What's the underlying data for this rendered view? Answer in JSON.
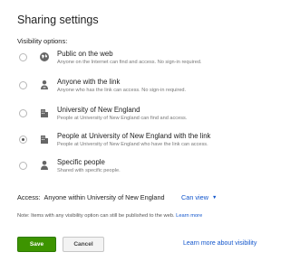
{
  "dialog": {
    "title": "Sharing settings",
    "section_label": "Visibility options:"
  },
  "options": [
    {
      "icon": "globe-icon",
      "title": "Public on the web",
      "description": "Anyone on the Internet can find and access. No sign-in required.",
      "selected": false
    },
    {
      "icon": "link-person-icon",
      "title": "Anyone with the link",
      "description": "Anyone who has the link can access. No sign-in required.",
      "selected": false
    },
    {
      "icon": "building-icon",
      "title": "University of New England",
      "description": "People at University of New England can find and access.",
      "selected": false
    },
    {
      "icon": "building-icon",
      "title": "People at University of New England with the link",
      "description": "People at University of New England who have the link can access.",
      "selected": true
    },
    {
      "icon": "person-icon",
      "title": "Specific people",
      "description": "Shared with specific people.",
      "selected": false
    }
  ],
  "access": {
    "label": "Access:",
    "value": "Anyone within University of New England",
    "permission": "Can view",
    "permission_caret": "▼"
  },
  "note": {
    "text": "Note: Items with any visibility option can still be published to the web.",
    "link": "Learn more"
  },
  "buttons": {
    "save": "Save",
    "cancel": "Cancel"
  },
  "footer_link": "Learn more about visibility",
  "colors": {
    "save_bg": "#3d9400",
    "link": "#1155cc"
  }
}
